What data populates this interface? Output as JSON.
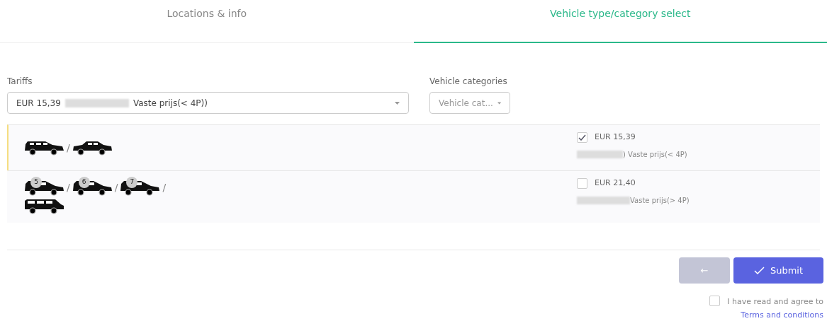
{
  "tabs": [
    {
      "label": "Locations & info",
      "selected": false
    },
    {
      "label": "Vehicle type/category select",
      "selected": true
    }
  ],
  "tariffs": {
    "label": "Tariffs",
    "value_prefix": "EUR 15,39",
    "value_suffix": "Vaste prijs(< 4P))",
    "redacted": true
  },
  "vehicle_categories": {
    "label": "Vehicle categories",
    "placeholder": "Vehicle cat..."
  },
  "options": [
    {
      "selected": true,
      "vehicles": [
        {
          "kind": "estate",
          "separator": "/"
        },
        {
          "kind": "sedan"
        }
      ],
      "price": "EUR 15,39",
      "description": ") Vaste prijs(< 4P)"
    },
    {
      "selected": false,
      "vehicles": [
        {
          "kind": "mpv",
          "seats": "5",
          "separator": "/"
        },
        {
          "kind": "mpv",
          "seats": "6",
          "separator": "/"
        },
        {
          "kind": "mpv",
          "seats": "7",
          "separator": "/"
        },
        {
          "kind": "van"
        }
      ],
      "price": "EUR 21,40",
      "description": "Vaste prijs(> 4P)"
    }
  ],
  "back_button": {
    "label": "←",
    "disabled": true
  },
  "submit_button": {
    "label": "Submit"
  },
  "agreement": {
    "checked": false,
    "text": "I have read and agree to",
    "link": "Terms and conditions"
  }
}
